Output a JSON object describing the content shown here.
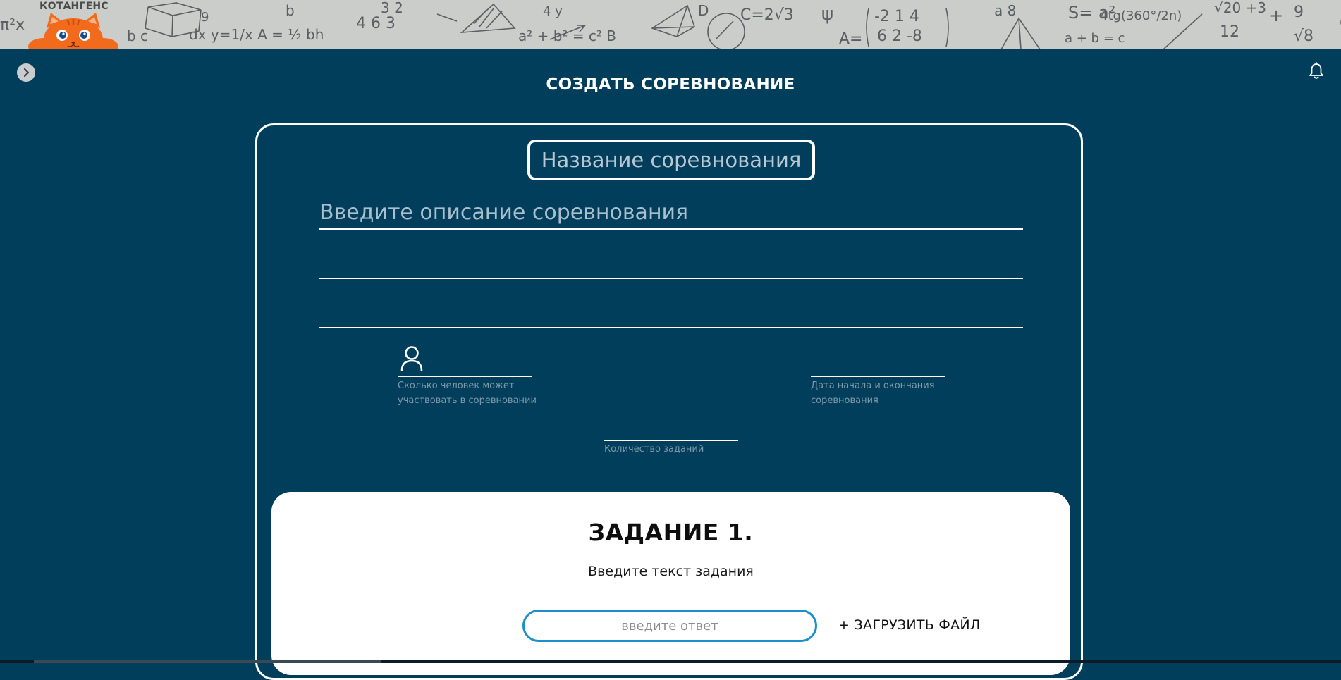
{
  "brand": {
    "logo_text": "КОТАНГЕНС",
    "background_formulas": [
      "A = 1/2 bh",
      "a² + b² = c²",
      "A = |-2 1 4; 6 2 -8|",
      "S = a²/4tg(360°/2n)",
      "√20 + 3 / 12",
      "9/√8",
      "a + b = c",
      "y = 1/x"
    ]
  },
  "page": {
    "title": "СОЗДАТЬ СОРЕВНОВАНИЕ"
  },
  "form": {
    "name_placeholder": "Название соревнования",
    "description_placeholder": "Введите описание соревнования",
    "participants_hint": "Сколько человек может участвовать в соревновании",
    "dates_hint": "Дата начала и окончания соревнования",
    "tasks_count_hint": "Количество заданий"
  },
  "task": {
    "title": "ЗАДАНИЕ 1.",
    "text_placeholder": "Введите текст задания",
    "answer_placeholder": "введите ответ",
    "upload_label": "+ ЗАГРУЗИТЬ ФАЙЛ"
  },
  "icons": {
    "toggle": "chevron-right-icon",
    "notifications": "bell-icon",
    "participants": "person-icon"
  },
  "colors": {
    "background": "#013e5b",
    "banner": "#cbcdcb",
    "accent": "#1a8fcc",
    "mascot": "#f26a1b"
  }
}
